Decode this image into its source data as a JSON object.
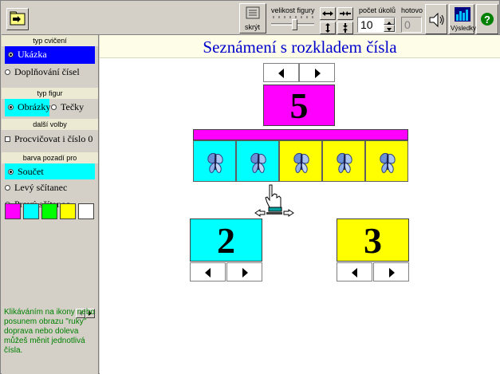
{
  "toolbar": {
    "hide_label": "skrýt",
    "size_label": "velikost figury",
    "count_label": "počet úkolů",
    "count_value": "10",
    "done_label": "hotovo",
    "done_value": "0",
    "results_label": "Výsledky"
  },
  "sidebar": {
    "exercise_type_title": "typ cvičení",
    "exercise_type_options": [
      "Ukázka",
      "Doplňování čísel"
    ],
    "figure_type_title": "typ figur",
    "figure_options": [
      "Obrázky",
      "Tečky"
    ],
    "more_options_title": "další volby",
    "practice_zero_label": "Procvičovat i číslo 0",
    "background_title": "barva pozadí pro",
    "background_options": [
      "Součet",
      "Levý sčítanec",
      "Pravý sčítanec"
    ],
    "swatch_colors": [
      "#ff00ff",
      "#00ffff",
      "#00ff00",
      "#ffff00",
      "#ffffff"
    ],
    "help_text": "Klikáváním na ikony nebo posunem obrazu \"ruky\" doprava nebo doleva můžeš měnit jednotlivá čísla."
  },
  "main": {
    "title": "Seznámení s rozkladem čísla",
    "total": "5",
    "left_addend": "2",
    "right_addend": "3",
    "tiles": [
      {
        "color": "#00ffff"
      },
      {
        "color": "#00ffff"
      },
      {
        "color": "#ffff00"
      },
      {
        "color": "#ffff00"
      },
      {
        "color": "#ffff00"
      }
    ]
  }
}
